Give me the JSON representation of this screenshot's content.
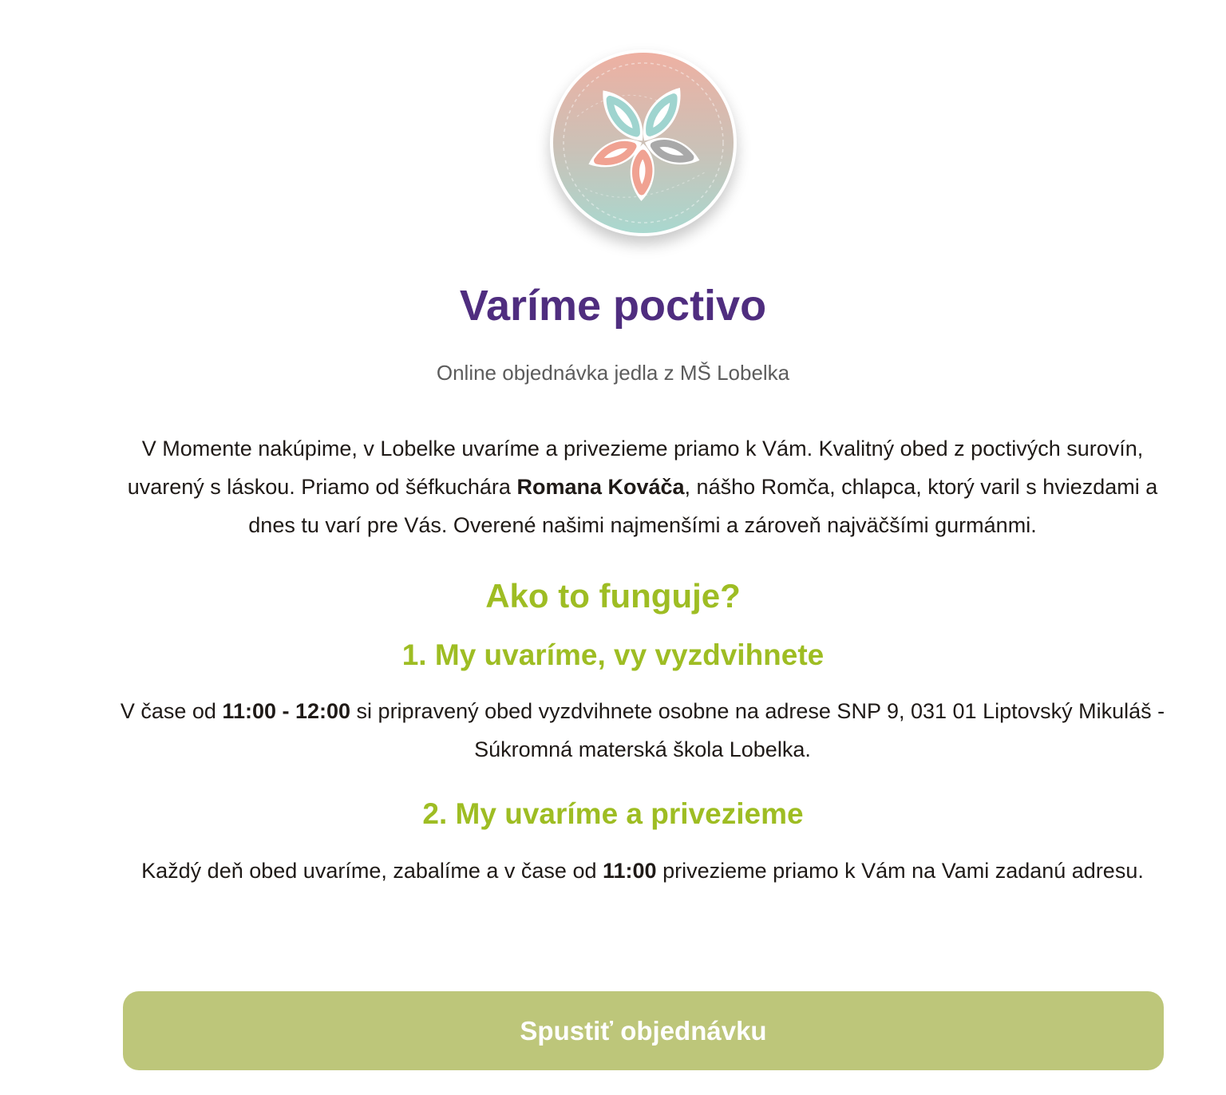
{
  "header": {
    "logo_icon": "lobelka-flower-icon",
    "title": "Varíme poctivo",
    "subtitle": "Online objednávka jedla z MŠ Lobelka"
  },
  "intro": {
    "before_bold": "V Momente nakúpime, v Lobelke uvaríme a privezieme priamo k Vám. Kvalitný obed z poctivých surovín, uvarený s láskou. Priamo od šéfkuchára ",
    "bold_name": "Romana Kováča",
    "after_bold": ", nášho Romča, chlapca, ktorý varil s hviezdami a dnes tu varí pre Vás. Overené našimi najmenšími a zároveň najväčšími gurmánmi."
  },
  "how_it_works": {
    "title": "Ako to funguje?",
    "steps": [
      {
        "title": "1. My uvaríme, vy vyzdvihnete",
        "text_before": "V čase od ",
        "bold": "11:00 - 12:00",
        "text_after": " si pripravený obed vyzdvihnete osobne na adrese SNP 9, 031 01 Liptovský Mikuláš - Súkromná materská škola Lobelka."
      },
      {
        "title": "2. My uvaríme a privezieme",
        "text_before": "Každý deň obed uvaríme, zabalíme a v čase od ",
        "bold": "11:00",
        "text_after": " privezieme priamo k Vám na Vami zadanú adresu."
      }
    ]
  },
  "cta": {
    "label": "Spustiť objednávku"
  },
  "colors": {
    "title_purple": "#4f2d7f",
    "accent_green": "#9ebd23",
    "button_green": "#bdc67a",
    "text_dark": "#1f1a17",
    "subtitle_gray": "#5c5c5c"
  }
}
